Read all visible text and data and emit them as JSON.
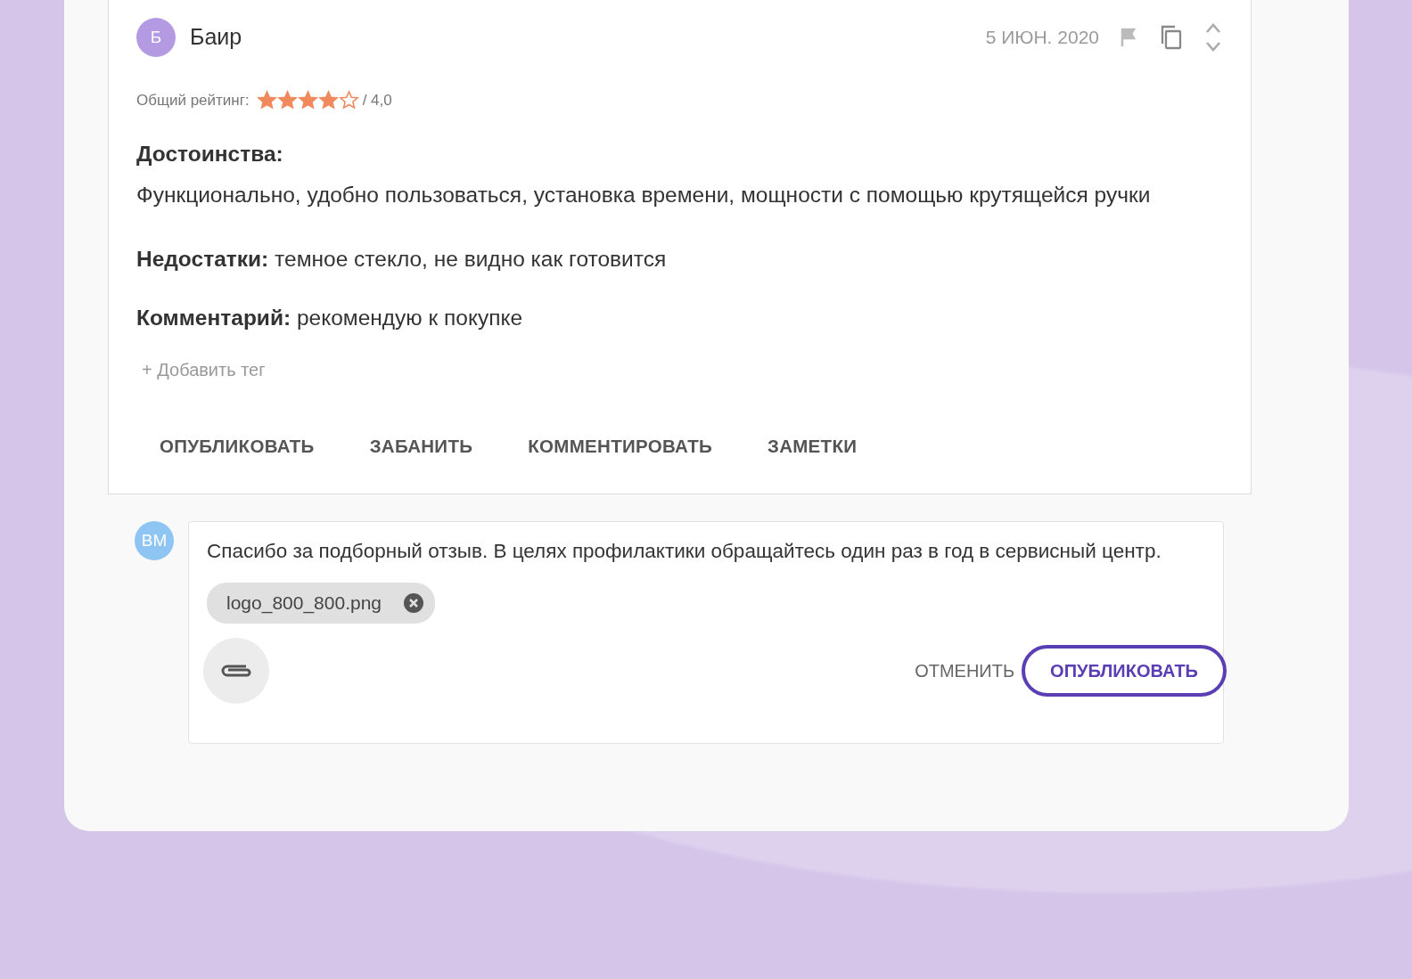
{
  "review": {
    "author_initial": "Б",
    "author": "Баир",
    "date": "5 ИЮН. 2020",
    "rating_label": "Общий рейтинг:",
    "stars": 4,
    "rating_text": "/ 4,0",
    "sections": [
      {
        "kind": "block",
        "label": "Достоинства:",
        "text": "Функционально, удобно пользоваться, установка времени, мощности с помощью крутящейся ручки"
      },
      {
        "kind": "inline",
        "label": "Недостатки:",
        "text": "темное стекло, не видно как готовится"
      },
      {
        "kind": "inline",
        "label": "Комментарий:",
        "text": "рекомендую к покупке"
      }
    ],
    "add_tag": "+ Добавить тег",
    "actions": [
      "ОПУБЛИКОВАТЬ",
      "ЗАБАНИТЬ",
      "КОММЕНТИРОВАТЬ",
      "ЗАМЕТКИ"
    ]
  },
  "reply": {
    "avatar": "ВМ",
    "text": "Спасибо за подборный отзыв. В целях профилактики обращайтесь один раз в год в сервисный центр.",
    "attachment": "logo_800_800.png",
    "cancel": "ОТМЕНИТЬ",
    "publish": "ОПУБЛИКОВАТЬ"
  }
}
